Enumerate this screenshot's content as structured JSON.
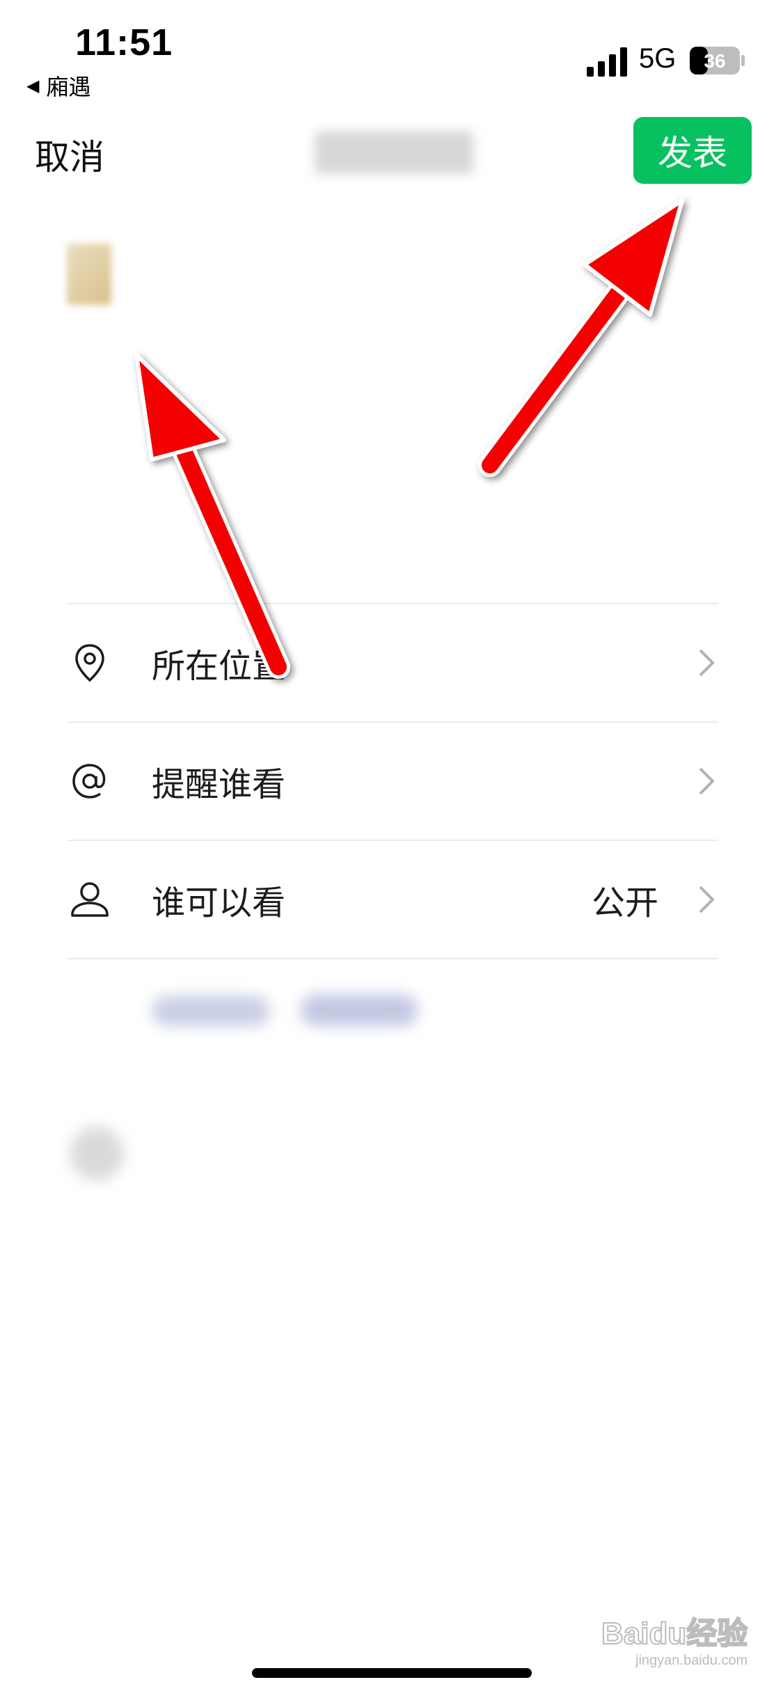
{
  "status_bar": {
    "time": "11:51",
    "back_app": "廂遇",
    "network": "5G",
    "battery": "36"
  },
  "nav": {
    "cancel_label": "取消",
    "publish_label": "发表"
  },
  "options": [
    {
      "label": "所在位置",
      "value": "",
      "icon": "location-pin-icon"
    },
    {
      "label": "提醒谁看",
      "value": "",
      "icon": "at-sign-icon"
    },
    {
      "label": "谁可以看",
      "value": "公开",
      "icon": "person-icon"
    }
  ],
  "watermark": {
    "text": "Baidu经验",
    "sub": "jingyan.baidu.com"
  },
  "colors": {
    "accent": "#07c160",
    "annotation_arrow": "#ff0000"
  }
}
